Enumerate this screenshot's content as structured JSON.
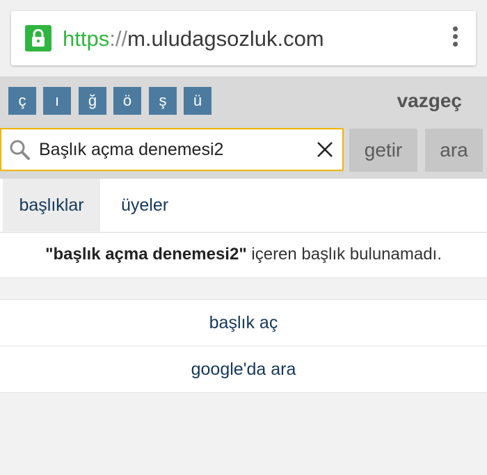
{
  "browser": {
    "url_scheme": "https",
    "url_separator": "://",
    "url_host": "m.uludagsozluk.com",
    "lock_icon": "lock-icon",
    "menu_icon": "kebab-menu-icon",
    "secure_color": "#2fb640"
  },
  "search_panel": {
    "chars": [
      "ç",
      "ı",
      "ğ",
      "ö",
      "ş",
      "ü"
    ],
    "cancel_label": "vazgeç",
    "query": "Başlık açma denemesi2",
    "search_icon": "search-icon",
    "clear_icon": "close-icon",
    "fetch_label": "getir",
    "search_label": "ara",
    "char_button_color": "#4c7b9f",
    "focus_border_color": "#f0b400"
  },
  "tabs": [
    {
      "label": "başlıklar",
      "active": true
    },
    {
      "label": "üyeler",
      "active": false
    }
  ],
  "result": {
    "quote_open": "\"",
    "query_bold": "başlık açma denemesi2",
    "quote_close": "\"",
    "suffix": " içeren başlık bulunamadı."
  },
  "actions": [
    {
      "label": "başlık aç"
    },
    {
      "label": "google'da ara"
    }
  ],
  "link_color": "#16385c"
}
